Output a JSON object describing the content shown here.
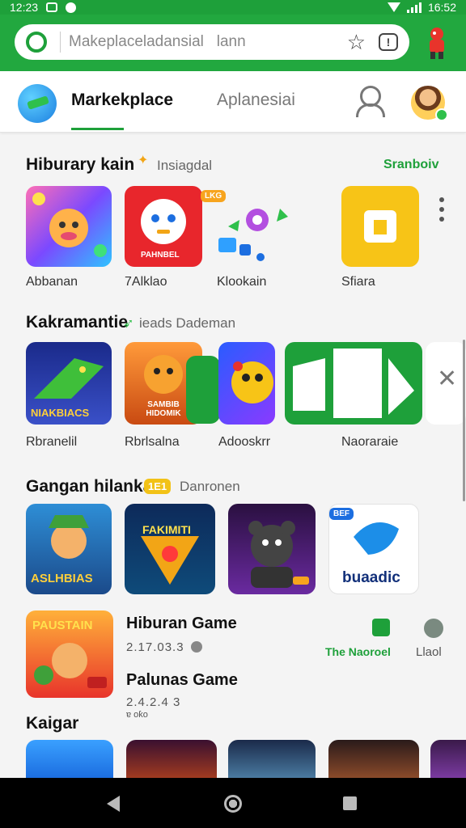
{
  "status_bar": {
    "time_left": "12:23",
    "time_right": "16:52"
  },
  "search": {
    "query": "Makeplaceladansial",
    "extra": "lann"
  },
  "nav": {
    "tab_active": "Markekplace",
    "tab_inactive": "Aplanesiai"
  },
  "section1": {
    "title": "Hiburary kain",
    "subtitle": "Insiagdal",
    "link": "Sranboiv",
    "items": [
      {
        "label": "Abbanan"
      },
      {
        "label": "7Alklao",
        "icon_text": "PAHNBEL"
      },
      {
        "label": "Klookain",
        "badge": "LKG"
      },
      {
        "label": "Sfiara"
      }
    ]
  },
  "section2": {
    "title": "Kakramantie",
    "subtitle": "ieads Dademan",
    "items": [
      {
        "label": "Rbranelil",
        "icon_text": "NIAKBIACS"
      },
      {
        "label": "Rbrlsalna",
        "icon_text": "SAMBIB HIDOMIK"
      },
      {
        "label": "Adooskrr"
      },
      {
        "label": "Naoraraie"
      }
    ]
  },
  "section3": {
    "title": "Gangan hilanka",
    "badge": "1E1",
    "subtitle": "Danronen",
    "items": [
      {
        "icon_text": "ASLHBIAS"
      },
      {
        "icon_text": "FAKIMITI"
      },
      {
        "icon_text": ""
      },
      {
        "icon_text": "buaadic",
        "badge": "BEF"
      }
    ]
  },
  "game_list": [
    {
      "title": "Hiburan Game",
      "meta": "2.17.03.3",
      "icon_text": "PAUSTAIN",
      "action1": "The Naoroel",
      "action2": "Llaol"
    },
    {
      "title": "Palunas Game",
      "meta": "2.4.2.4 3",
      "sub": "ɐ oƙo"
    }
  ],
  "section4": {
    "title": "Kaigar"
  },
  "colors": {
    "brand": "#1ea03a",
    "accent": "#f2a516"
  }
}
